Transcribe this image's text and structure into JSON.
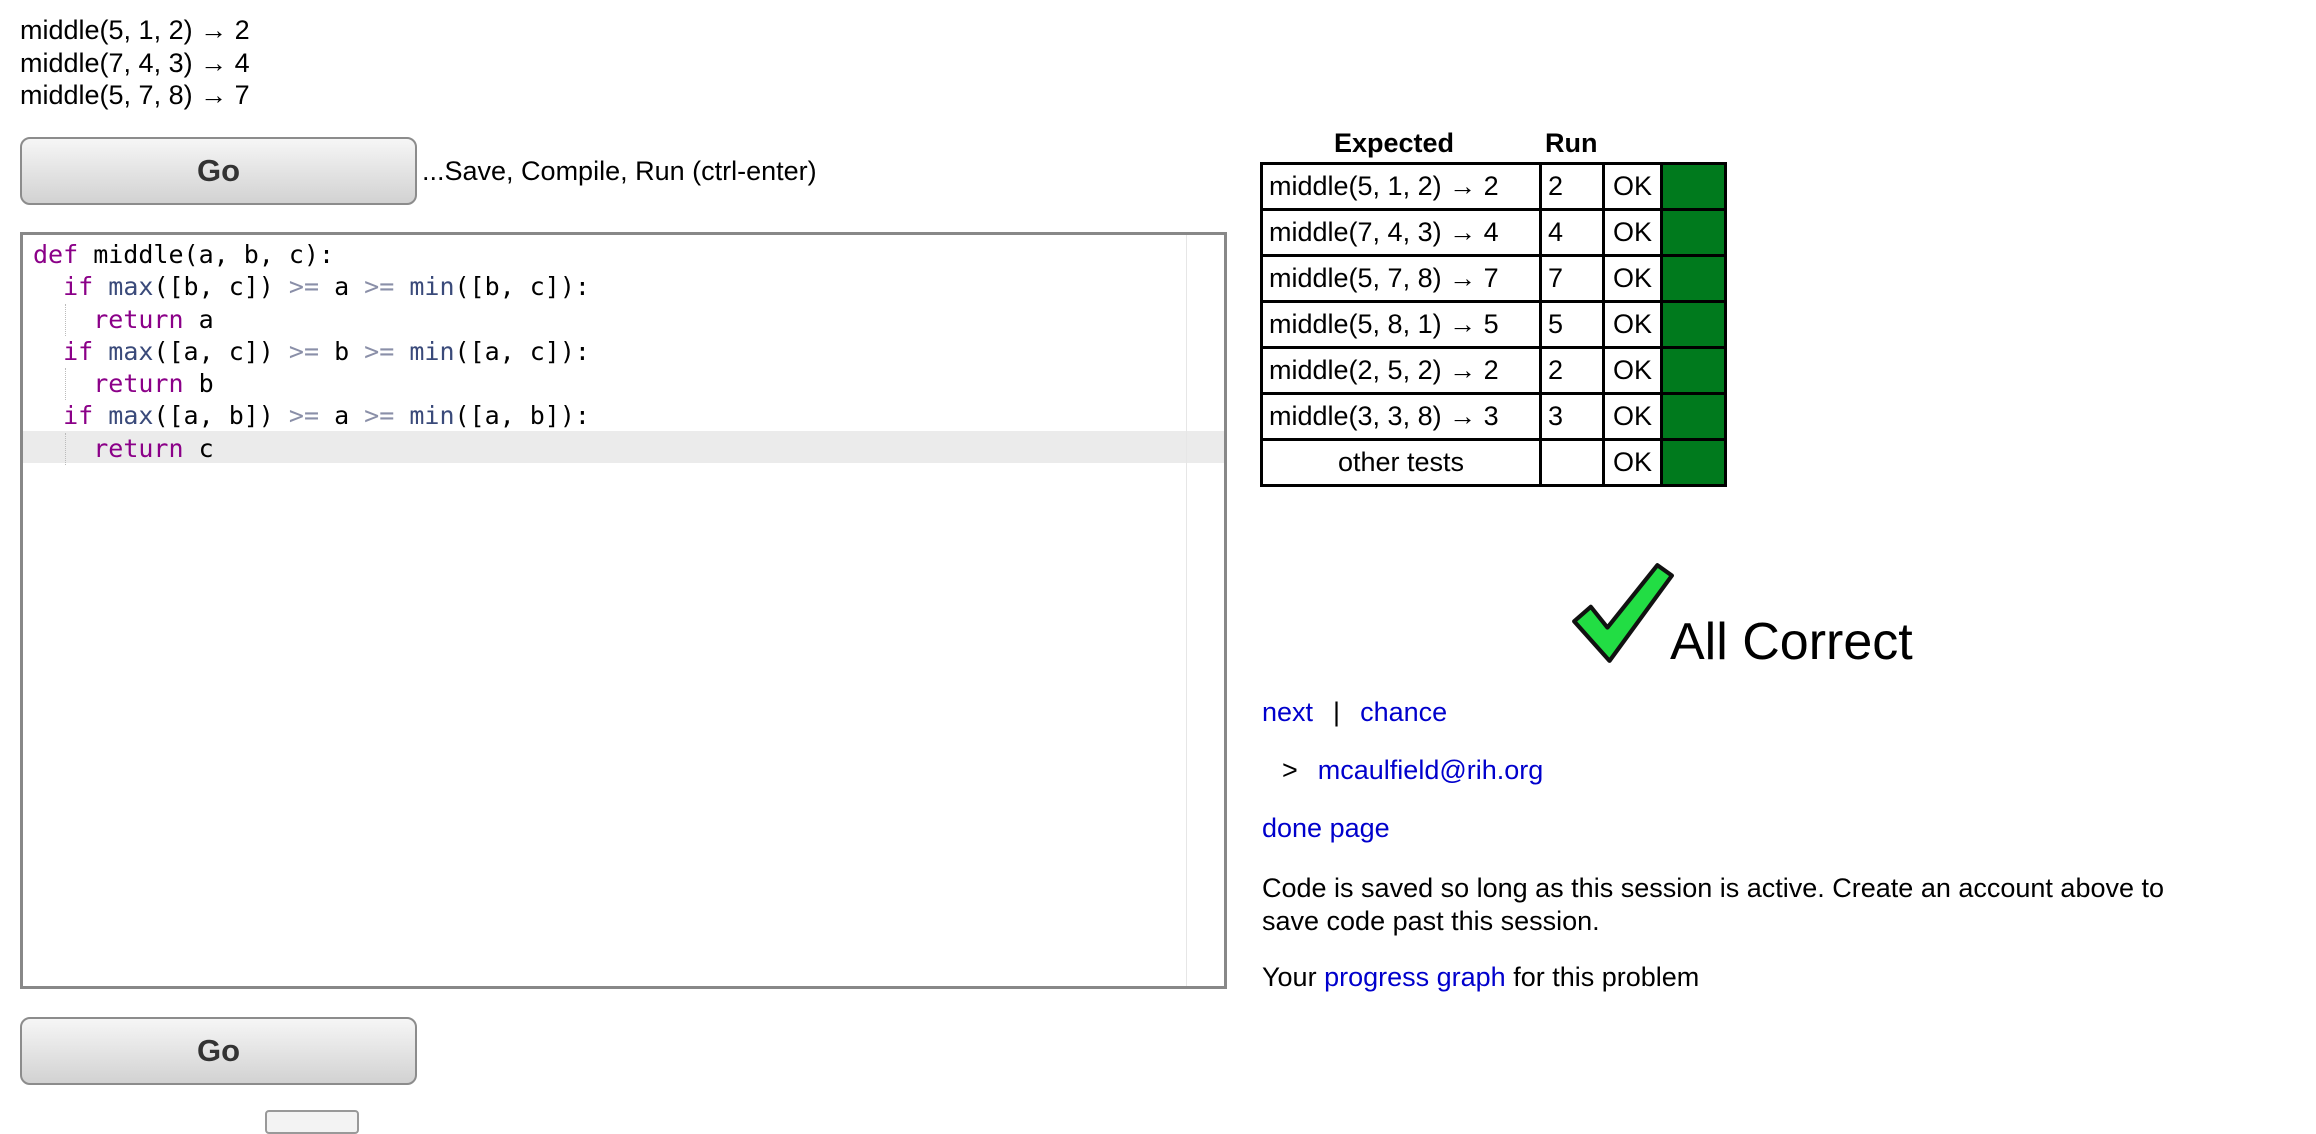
{
  "examples": [
    "middle(5, 1, 2) → 2",
    "middle(7, 4, 3) → 4",
    "middle(5, 7, 8) → 7"
  ],
  "go_label": "Go",
  "go_hint": "...Save, Compile, Run (ctrl-enter)",
  "results": {
    "headers": {
      "expected": "Expected",
      "run": "Run"
    },
    "rows": [
      {
        "expected": "middle(5, 1, 2) → 2",
        "run": "2",
        "result": "OK"
      },
      {
        "expected": "middle(7, 4, 3) → 4",
        "run": "4",
        "result": "OK"
      },
      {
        "expected": "middle(5, 7, 8) → 7",
        "run": "7",
        "result": "OK"
      },
      {
        "expected": "middle(5, 8, 1) → 5",
        "run": "5",
        "result": "OK"
      },
      {
        "expected": "middle(2, 5, 2) → 2",
        "run": "2",
        "result": "OK"
      },
      {
        "expected": "middle(3, 3, 8) → 3",
        "run": "3",
        "result": "OK"
      },
      {
        "expected": "other tests",
        "run": "",
        "result": "OK"
      }
    ],
    "pass_color": "#007a1d"
  },
  "status": {
    "text": "All Correct",
    "icon": "checkmark-icon",
    "icon_color": "#22cc44"
  },
  "links": {
    "next": "next",
    "separator": "|",
    "chance": "chance",
    "user_arrow": ">",
    "user_email": "mcaulfield@rih.org",
    "done_page": "done page"
  },
  "note": "Code is saved so long as this session is active. Create an account above to save code past this session.",
  "progress": {
    "prefix": "Your",
    "link": "progress graph",
    "suffix": "for this problem"
  }
}
